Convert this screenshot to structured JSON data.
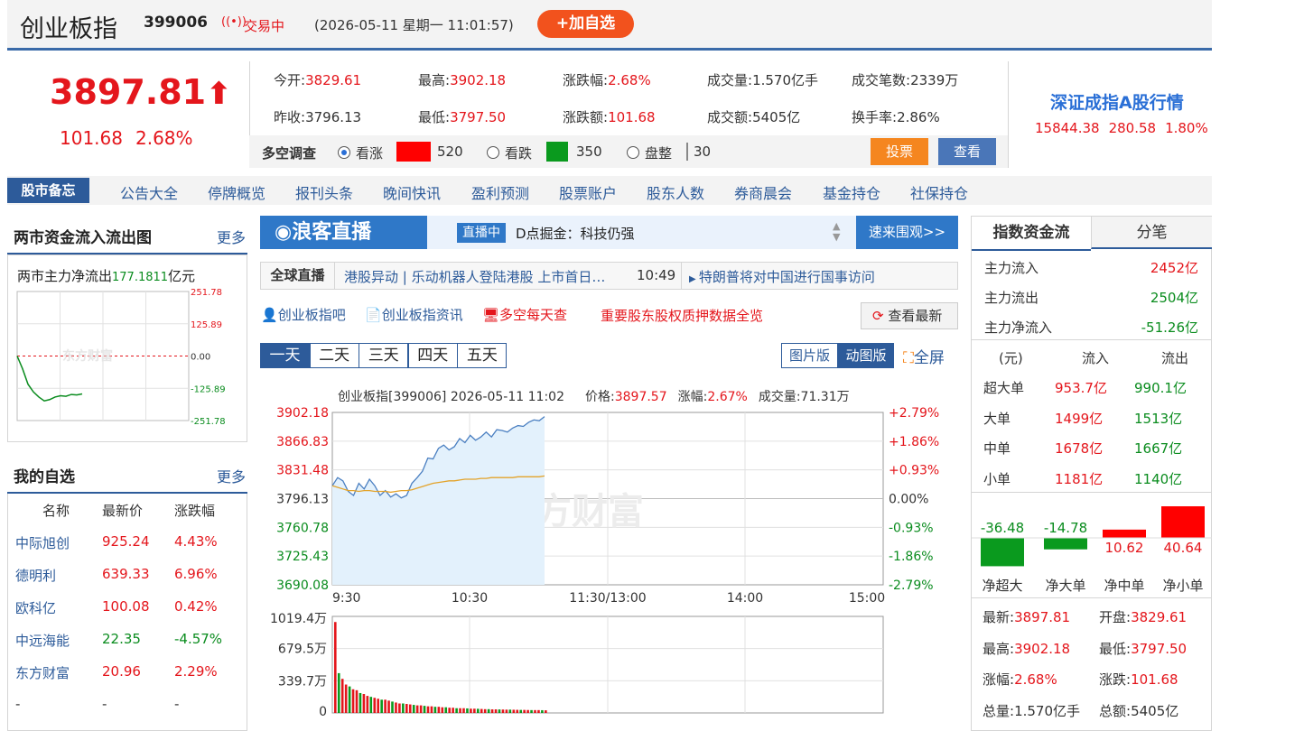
{
  "header": {
    "name": "创业板指",
    "code": "399006",
    "trade_status": "交易中",
    "datetime": "(2026-05-11 星期一 11:01:57)",
    "add_fav": "+加自选",
    "signal_icon": "broadcast-icon"
  },
  "quote": {
    "price": "3897.81",
    "arrow": "🠕",
    "change": "101.68",
    "pct": "2.68%"
  },
  "stats": [
    {
      "label": "今开:",
      "value": "3829.61",
      "color": "red"
    },
    {
      "label": "最高:",
      "value": "3902.18",
      "color": "red"
    },
    {
      "label": "涨跌幅:",
      "value": "2.68%",
      "color": "red"
    },
    {
      "label": "成交量:",
      "value": "1.570亿手",
      "color": "plain"
    },
    {
      "label": "成交笔数:",
      "value": "2339万",
      "color": "plain"
    },
    {
      "label": "昨收:",
      "value": "3796.13",
      "color": "plain"
    },
    {
      "label": "最低:",
      "value": "3797.50",
      "color": "red"
    },
    {
      "label": "涨跌额:",
      "value": "101.68",
      "color": "red"
    },
    {
      "label": "成交额:",
      "value": "5405亿",
      "color": "plain"
    },
    {
      "label": "换手率:",
      "value": "2.86%",
      "color": "plain"
    }
  ],
  "poll": {
    "label": "多空调查",
    "bull": "看涨",
    "bull_count": "520",
    "bear": "看跌",
    "bear_count": "350",
    "flat": "盘整",
    "flat_count": "30",
    "vote": "投票",
    "view": "查看",
    "bull_color": "#ff0000",
    "bear_color": "#0a9a1e"
  },
  "related": {
    "title": "深证成指A股行情",
    "price": "15844.38",
    "change": "280.58",
    "pct": "1.80%"
  },
  "nav": {
    "active": "股市备忘",
    "items": [
      "公告大全",
      "停牌概览",
      "报刊头条",
      "晚间快讯",
      "盈利预测",
      "股票账户",
      "股东人数",
      "券商晨会",
      "基金持仓",
      "社保持仓"
    ]
  },
  "fund_flow": {
    "title": "两市资金流入流出图",
    "more": "更多",
    "label": "两市主力净流出",
    "value": "177.1811",
    "unit": "亿元",
    "ticks": [
      "251.78",
      "125.89",
      "0.00",
      "-125.89",
      "-251.78"
    ],
    "series": [
      0,
      -50,
      -110,
      -140,
      -160,
      -175,
      -170,
      -160,
      -155,
      -157,
      -150,
      -152,
      -148
    ],
    "ymin": -251.78,
    "ymax": 251.78,
    "watermark": "东方财富"
  },
  "watchlist": {
    "title": "我的自选",
    "more": "更多",
    "headers": [
      "名称",
      "最新价",
      "涨跌幅"
    ],
    "rows": [
      {
        "name": "中际旭创",
        "price": "925.24",
        "pct": "4.43%",
        "up": true
      },
      {
        "name": "德明利",
        "price": "639.33",
        "pct": "6.96%",
        "up": true
      },
      {
        "name": "欧科亿",
        "price": "100.08",
        "pct": "0.42%",
        "up": true
      },
      {
        "name": "中远海能",
        "price": "22.35",
        "pct": "-4.57%",
        "up": false
      },
      {
        "name": "东方财富",
        "price": "20.96",
        "pct": "2.29%",
        "up": true
      },
      {
        "name": "-",
        "price": "-",
        "pct": "-",
        "up": null
      }
    ]
  },
  "live": {
    "logo": "浪客直播",
    "badge": "直播中",
    "text": "D点掘金：科技仍强",
    "cta": "速来围观>>",
    "ticker_label": "全球直播",
    "ticker_text": "港股异动 | 乐动机器人登陆港股 上市首日…",
    "ticker_time": "10:49",
    "ticker_right": "特朗普将对中国进行国事访问"
  },
  "links": {
    "bar": "创业板指吧",
    "news": "创业板指资讯",
    "daily": "多空每天查",
    "pledge": "重要股东股权质押数据全览",
    "latest": "查看最新"
  },
  "tabs": [
    "一天",
    "二天",
    "三天",
    "四天",
    "五天"
  ],
  "view_modes": {
    "image": "图片版",
    "dynamic": "动图版",
    "fullscreen": "全屏"
  },
  "chart_data": {
    "type": "line",
    "title": "创业板指[399006]  2026-05-11 11:02",
    "price_label": "价格:",
    "price": "3897.57",
    "pct_label": "涨幅:",
    "pct": "2.67%",
    "vol_label": "成交量:",
    "volume": "71.31万",
    "x_ticks": [
      "9:30",
      "10:30",
      "11:30/13:00",
      "14:00",
      "15:00"
    ],
    "y_left": [
      "3902.18",
      "3866.83",
      "3831.48",
      "3796.13",
      "3760.78",
      "3725.43",
      "3690.08"
    ],
    "y_right": [
      "+2.79%",
      "+1.86%",
      "+0.93%",
      "0.00%",
      "-0.93%",
      "-1.86%",
      "-2.79%"
    ],
    "ylim": [
      3690.08,
      3902.18
    ],
    "watermark": "东方财富",
    "series": [
      {
        "values": [
          3812,
          3822,
          3818,
          3805,
          3800,
          3815,
          3808,
          3820,
          3812,
          3800,
          3806,
          3798,
          3802,
          3797,
          3800,
          3815,
          3822,
          3830,
          3846,
          3845,
          3858,
          3862,
          3856,
          3860,
          3870,
          3865,
          3874,
          3868,
          3872,
          3878,
          3872,
          3881,
          3880,
          3878,
          3883,
          3886,
          3885,
          3890,
          3893,
          3892,
          3897
        ]
      },
      {
        "values": [
          3812,
          3810,
          3808,
          3806,
          3806,
          3805,
          3806,
          3806,
          3805,
          3805,
          3805,
          3804,
          3805,
          3806,
          3806,
          3807,
          3809,
          3811,
          3813,
          3815,
          3816,
          3817,
          3818,
          3818,
          3819,
          3820,
          3820,
          3820,
          3821,
          3821,
          3822,
          3822,
          3822,
          3822,
          3822,
          3823,
          3823,
          3823,
          3823,
          3823,
          3824
        ]
      }
    ],
    "volume_ticks": [
      "1019.4万",
      "679.5万",
      "339.7万",
      "0"
    ],
    "volume_max": 1019.4,
    "volume_values": [
      960,
      420,
      360,
      300,
      280,
      250,
      240,
      210,
      200,
      180,
      170,
      160,
      150,
      140,
      140,
      130,
      120,
      110,
      100,
      100,
      95,
      90,
      85,
      80,
      80,
      75,
      70,
      70,
      65,
      65,
      60,
      60,
      55,
      55,
      50,
      50,
      50,
      48,
      45,
      45,
      44,
      42,
      40,
      40,
      38,
      38,
      37,
      36,
      35,
      35,
      34,
      33,
      32,
      32,
      31,
      30,
      30,
      30,
      29,
      28
    ]
  },
  "index_flow": {
    "tab_active": "指数资金流",
    "tab_other": "分笔",
    "inflow_label": "主力流入",
    "inflow": "2452亿",
    "outflow_label": "主力流出",
    "outflow": "2504亿",
    "net_label": "主力净流入",
    "net": "-51.26亿",
    "headers": [
      "(元)",
      "流入",
      "流出"
    ],
    "rows": [
      {
        "label": "超大单",
        "in": "953.7亿",
        "out": "990.1亿"
      },
      {
        "label": "大单",
        "in": "1499亿",
        "out": "1513亿"
      },
      {
        "label": "中单",
        "in": "1678亿",
        "out": "1667亿"
      },
      {
        "label": "小单",
        "in": "1181亿",
        "out": "1140亿"
      }
    ],
    "bars": [
      {
        "label": "净超大",
        "value": -36.48
      },
      {
        "label": "净大单",
        "value": -14.78
      },
      {
        "label": "净中单",
        "value": 10.62
      },
      {
        "label": "净小单",
        "value": 40.64
      }
    ],
    "bar_texts": [
      "-36.48",
      "-14.78",
      "10.62",
      "40.64"
    ]
  },
  "summary": [
    {
      "label": "最新:",
      "value": "3897.81"
    },
    {
      "label": "开盘:",
      "value": "3829.61"
    },
    {
      "label": "最高:",
      "value": "3902.18"
    },
    {
      "label": "最低:",
      "value": "3797.50"
    },
    {
      "label": "涨幅:",
      "value": "2.68%"
    },
    {
      "label": "涨跌:",
      "value": "101.68"
    },
    {
      "label": "总量:",
      "value": "1.570亿手"
    },
    {
      "label": "总额:",
      "value": "5405亿"
    }
  ]
}
